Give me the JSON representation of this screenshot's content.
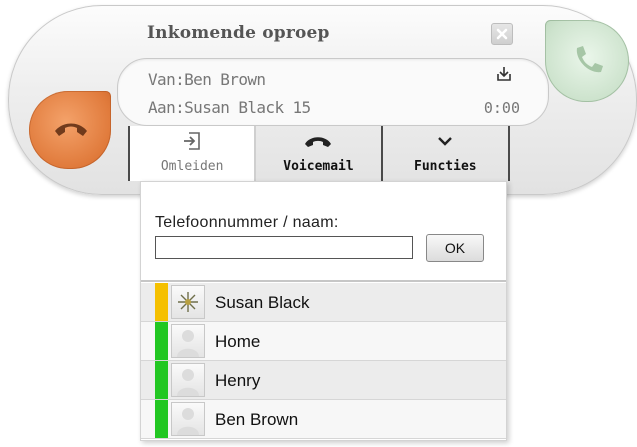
{
  "call": {
    "title": "Inkomende oproep",
    "from_line": "Van:Ben Brown",
    "to_line": "Aan:Susan Black 15",
    "timer": "0:00"
  },
  "icons": {
    "decline": "hang-up-phone-icon",
    "accept": "phone-handset-icon",
    "close": "close-icon",
    "download": "download-tray-icon"
  },
  "colors": {
    "decline": "#e07a3b",
    "accept": "#cde3cd",
    "status_busy": "#f5c000",
    "status_available": "#22c722"
  },
  "actions": [
    {
      "label": "Omleiden",
      "icon": "redirect-icon"
    },
    {
      "label": "Voicemail",
      "icon": "voicemail-icon"
    },
    {
      "label": "Functies",
      "icon": "chevron-down-icon"
    }
  ],
  "redirect": {
    "label": "Telefoonnummer / naam:",
    "input_value": "",
    "ok_label": "OK"
  },
  "contacts": [
    {
      "name": "Susan Black",
      "status": "busy",
      "avatar": "photo"
    },
    {
      "name": "Home",
      "status": "available",
      "avatar": "placeholder"
    },
    {
      "name": "Henry",
      "status": "available",
      "avatar": "placeholder"
    },
    {
      "name": "Ben Brown",
      "status": "available",
      "avatar": "placeholder"
    }
  ]
}
